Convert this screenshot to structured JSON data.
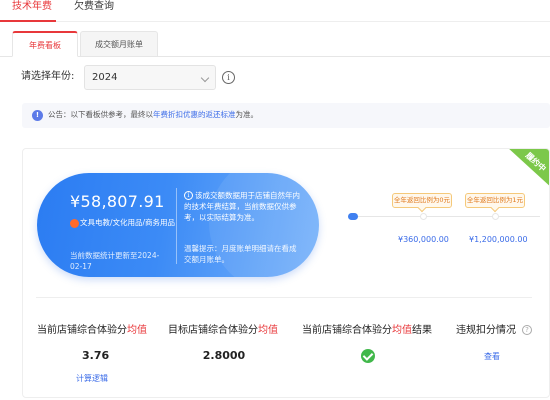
{
  "top_tabs": [
    {
      "label": "技术年费"
    },
    {
      "label": "欠费查询"
    }
  ],
  "sub_tabs": [
    {
      "label": "年费看板"
    },
    {
      "label": "成交额月账单"
    }
  ],
  "filter": {
    "year_label": "请选择年份:",
    "year_value": "2024",
    "info_glyph": "i"
  },
  "notice": {
    "icon_glyph": "!",
    "prefix": "公告：以下看板供参考，最终以",
    "link": "年费折扣优惠的返还标准",
    "suffix": "为准。"
  },
  "badge": {
    "label": "履约中",
    "color": "#7cc84a"
  },
  "summary": {
    "amount": "¥58,807.91",
    "category": "文具电教/文化用品/商务用品",
    "update_note": "当前数据统计更新至2024-02-17",
    "info_glyph": "i",
    "description": "该成交额数据用于店铺自然年内的技术年费结算，当前数据仅供参考，以实际结算为准。",
    "tip": "温馨提示：月度账单明细请在看成交额月账单。"
  },
  "progress": {
    "tiers": [
      {
        "tooltip": "全年返回比例为0元",
        "threshold": "¥360,000.00"
      },
      {
        "tooltip": "全年返回比例为1元",
        "threshold": "¥1,200,000.00"
      }
    ]
  },
  "metrics": [
    {
      "title_before": "当前店铺综合体验分",
      "title_highlight": "均值",
      "title_after": "",
      "value": "3.76",
      "link": "计算逻辑"
    },
    {
      "title_before": "目标店铺综合体验分",
      "title_highlight": "均值",
      "title_after": "",
      "value": "2.8000"
    },
    {
      "title_before": "当前店铺综合体验分",
      "title_highlight": "均值",
      "title_after": "结果",
      "value_icon": "check-circle-icon"
    },
    {
      "title_before": "违规扣分情况",
      "title_highlight": "",
      "title_after": "",
      "info_glyph": "?",
      "link": "查看"
    }
  ],
  "colors": {
    "accent": "#e8383b",
    "link": "#3a6be8",
    "pill_blue": "#3c8bf6",
    "success": "#41b84b",
    "warning": "#e07a1f"
  }
}
